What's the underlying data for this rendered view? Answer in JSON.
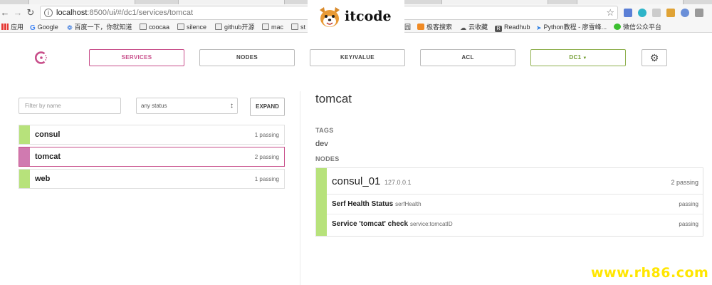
{
  "browser": {
    "url_prefix": "localhost",
    "url_rest": ":8500/ui/#/dc1/services/tomcat",
    "bookmarks": [
      "应用",
      "Google",
      "百度一下，你就知道",
      "coocaa",
      "silence",
      "github开源",
      "mac",
      "st",
      "园",
      "极客搜索",
      "云收藏",
      "Readhub",
      "Python教程 - 廖雪峰...",
      "微信公众平台"
    ]
  },
  "watermark": {
    "logo_text": "itcode",
    "site": "www.rh86.com"
  },
  "nav": {
    "services": "SERVICES",
    "nodes": "NODES",
    "keyvalue": "KEY/VALUE",
    "acl": "ACL",
    "datacenter": "DC1",
    "accent_color": "#c84e8a",
    "dc_color": "#8fb04f"
  },
  "filter": {
    "placeholder": "Filter by name",
    "status": "any status",
    "expand": "EXPAND"
  },
  "services": [
    {
      "name": "consul",
      "status": "1 passing"
    },
    {
      "name": "tomcat",
      "status": "2 passing"
    },
    {
      "name": "web",
      "status": "1 passing"
    }
  ],
  "detail": {
    "title": "tomcat",
    "tags_label": "TAGS",
    "tag": "dev",
    "nodes_label": "NODES",
    "node": {
      "name": "consul_01",
      "address": "127.0.0.1",
      "status": "2 passing",
      "checks": [
        {
          "name": "Serf Health Status",
          "id": "serfHealth",
          "status": "passing"
        },
        {
          "name": "Service 'tomcat' check",
          "id": "service:tomcatID",
          "status": "passing"
        }
      ]
    }
  }
}
